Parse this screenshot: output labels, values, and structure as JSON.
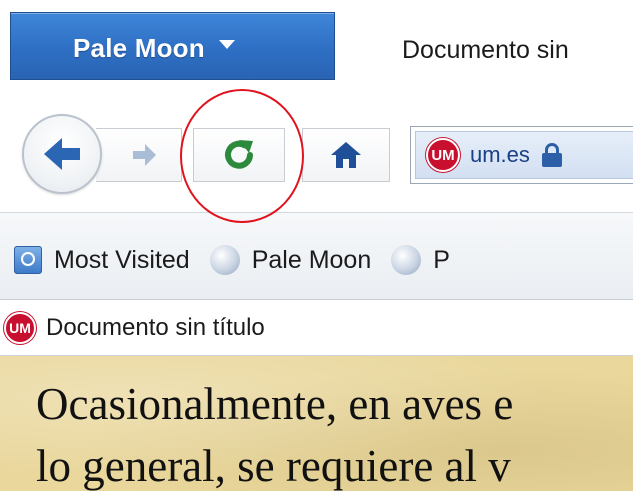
{
  "app": {
    "menu_label": "Pale Moon",
    "tab_title": "Documento sin"
  },
  "navbar": {
    "url_domain": "um.es",
    "site_badge": "UM",
    "reload_highlighted": true
  },
  "bookmarks": {
    "items": [
      {
        "label": "Most Visited",
        "icon": "most-visited-icon"
      },
      {
        "label": "Pale Moon",
        "icon": "pale-moon-icon"
      },
      {
        "label": "P",
        "icon": "pale-moon-icon"
      }
    ]
  },
  "page_tab": {
    "badge": "UM",
    "title": "Documento sin título"
  },
  "content": {
    "line1": "Ocasionalmente, en aves e",
    "line2": "lo general, se requiere al v"
  },
  "colors": {
    "menu_blue": "#2e6fc4",
    "reload_green": "#2d8a3c",
    "home_blue": "#1f4f99",
    "annotation_red": "#e0141e",
    "um_red": "#c8102e",
    "parchment": "#e9d79c"
  }
}
